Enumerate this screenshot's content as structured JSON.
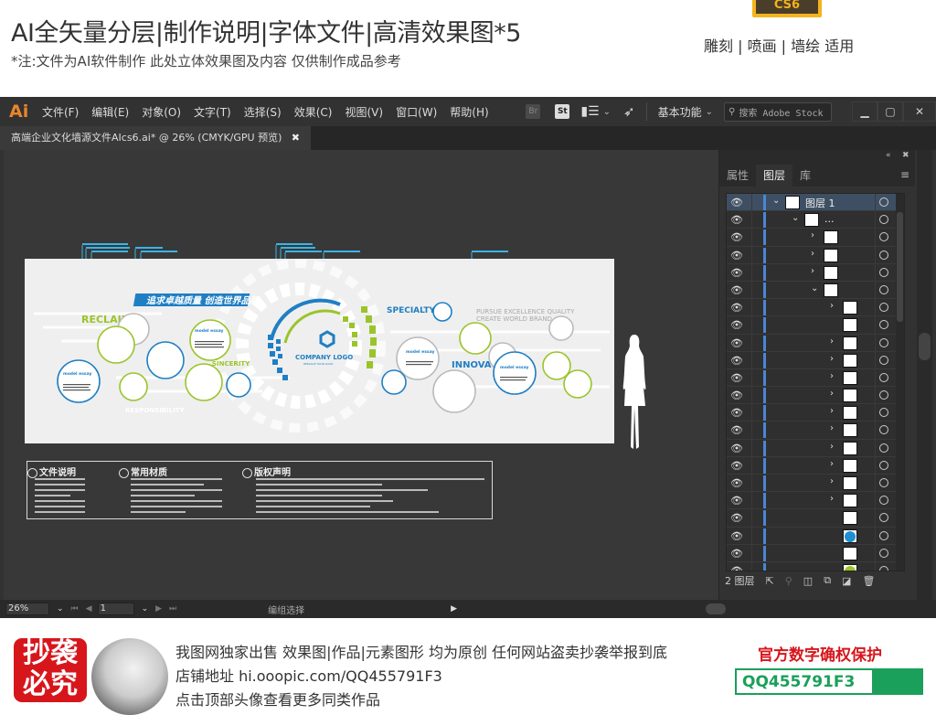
{
  "header": {
    "title": "AI全矢量分层|制作说明|字体文件|高清效果图*5",
    "note": "*注:文件为AI软件制作 此处立体效果图及内容 仅供制作成品参考",
    "version_badge": "CS6",
    "usage": "雕刻 | 喷画 | 墙绘 适用"
  },
  "app": {
    "logo": "Ai",
    "menu": [
      "文件(F)",
      "编辑(E)",
      "对象(O)",
      "文字(T)",
      "选择(S)",
      "效果(C)",
      "视图(V)",
      "窗口(W)",
      "帮助(H)"
    ],
    "bridge_label": "Br",
    "stock_label": "St",
    "workspace": "基本功能",
    "stock_search_placeholder": "搜索 Adobe Stock",
    "document_tab": "高端企业文化墙源文件AIcs6.ai* @ 26% (CMYK/GPU 预览)",
    "artboard": {
      "slogan": "追求卓越质量 创造世界品牌",
      "words": [
        "RECLAIM",
        "SINCERITY",
        "RESPONSIBILITY",
        "SPECIALTY",
        "INNOVATE"
      ],
      "logo_text": "COMPANY LOGO",
      "logo_sub": "REPLACE YOUR LOGO",
      "tagline_1": "PURSUE EXCELLENCE QUALITY",
      "tagline_2": "CREATE WORLD BRAND",
      "model_essay": "model essay"
    },
    "info_sections": [
      "文件说明",
      "常用材质",
      "版权声明"
    ],
    "panel": {
      "tabs": [
        "属性",
        "图层",
        "库"
      ],
      "active_tab": "图层",
      "layers": [
        {
          "name": "图层 1",
          "depth": 0,
          "expanded": true,
          "selected": true
        },
        {
          "name": "...",
          "depth": 1,
          "expanded": true
        },
        {
          "name": "",
          "depth": 2,
          "expanded": false
        },
        {
          "name": "",
          "depth": 2,
          "expanded": false
        },
        {
          "name": "",
          "depth": 2,
          "expanded": false
        },
        {
          "name": "",
          "depth": 2,
          "expanded": true
        },
        {
          "name": "",
          "depth": 3,
          "expanded": false
        },
        {
          "name": "",
          "depth": 3
        },
        {
          "name": "",
          "depth": 3,
          "expanded": false
        },
        {
          "name": "",
          "depth": 3,
          "expanded": false
        },
        {
          "name": "",
          "depth": 3,
          "expanded": false
        },
        {
          "name": "",
          "depth": 3,
          "expanded": false
        },
        {
          "name": "",
          "depth": 3,
          "expanded": false
        },
        {
          "name": "",
          "depth": 3,
          "expanded": false
        },
        {
          "name": "",
          "depth": 3,
          "expanded": false
        },
        {
          "name": "",
          "depth": 3,
          "expanded": false
        },
        {
          "name": "",
          "depth": 3,
          "expanded": false
        },
        {
          "name": "",
          "depth": 3,
          "expanded": false
        },
        {
          "name": "",
          "depth": 3
        },
        {
          "name": "",
          "depth": 3,
          "thumb": "blue-circle"
        },
        {
          "name": "",
          "depth": 3
        },
        {
          "name": "",
          "depth": 3,
          "thumb": "green-circle"
        }
      ],
      "layer_count": "2 图层"
    },
    "status": {
      "zoom": "26%",
      "page": "1",
      "mode": "编组选择"
    }
  },
  "footer": {
    "stamp": "抄袭必究",
    "line1": "我图网独家出售 效果图|作品|元素图形 均为原创 任何网站盗卖抄袭举报到底",
    "line2": "店铺地址 hi.ooopic.com/QQ455791F3",
    "line3": "点击顶部头像查看更多同类作品",
    "official": "官方数字确权保护",
    "qq_id": "QQ455791F3"
  },
  "colors": {
    "accent_blue": "#1f7fc4",
    "accent_green": "#9ac42a",
    "ai_orange": "#e8862c",
    "footer_red": "#d7161c",
    "footer_green": "#1aa05a"
  }
}
